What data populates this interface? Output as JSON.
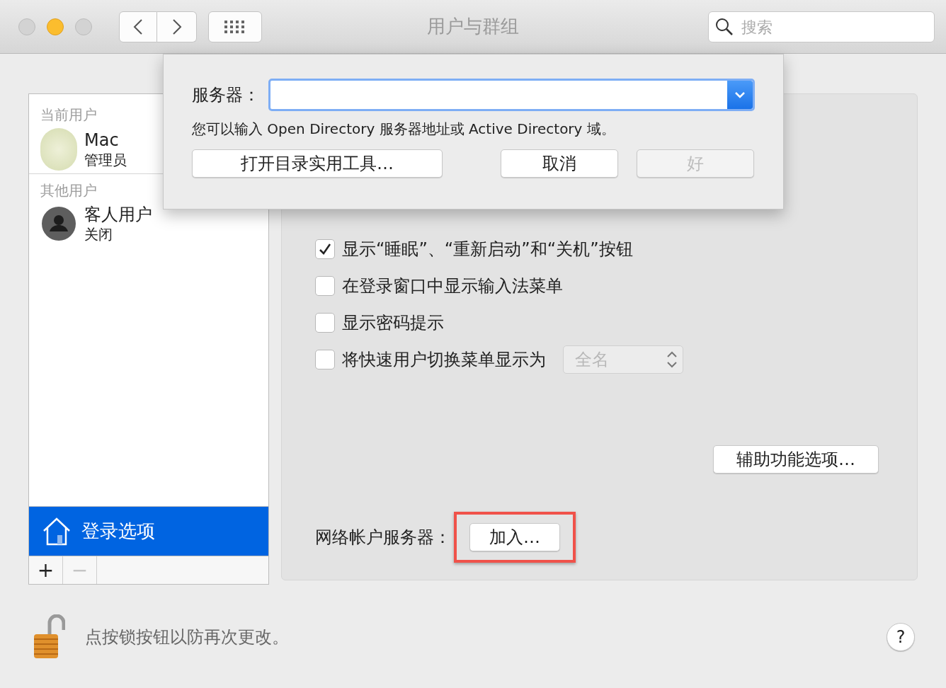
{
  "window": {
    "title": "用户与群组",
    "search": {
      "placeholder": "搜索"
    }
  },
  "sidebar": {
    "sections": [
      {
        "header": "当前用户",
        "users": [
          {
            "name": "Mac",
            "role": "管理员",
            "kind": "photo"
          }
        ]
      },
      {
        "header": "其他用户",
        "users": [
          {
            "name": "客人用户",
            "role": "关闭",
            "kind": "guest"
          }
        ]
      }
    ],
    "login_options": {
      "label": "登录选项",
      "selected": true
    },
    "buttons": [
      {
        "label": "+",
        "disabled": false
      },
      {
        "label": "−",
        "disabled": true
      }
    ]
  },
  "options": {
    "checkboxes": [
      {
        "label": "显示“睡眠”、“重新启动”和“关机”按钮",
        "checked": true
      },
      {
        "label": "在登录窗口中显示输入法菜单",
        "checked": false
      },
      {
        "label": "显示密码提示",
        "checked": false
      },
      {
        "label": "将快速用户切换菜单显示为",
        "checked": false,
        "popup": {
          "value": "全名",
          "disabled": true
        }
      }
    ],
    "accessibility_button": "辅助功能选项…",
    "network_server": {
      "label": "网络帐户服务器：",
      "button": "加入…",
      "highlighted": true
    }
  },
  "sheet": {
    "server_label": "服务器：",
    "hint": "您可以输入 Open Directory 服务器地址或 Active Directory 域。",
    "buttons": [
      {
        "label": "打开目录实用工具…",
        "disabled": false
      },
      {
        "label": "取消",
        "disabled": false
      },
      {
        "label": "好",
        "disabled": true
      }
    ]
  },
  "footer": {
    "lock_text": "点按锁按钮以防再次更改。",
    "help": "?"
  }
}
